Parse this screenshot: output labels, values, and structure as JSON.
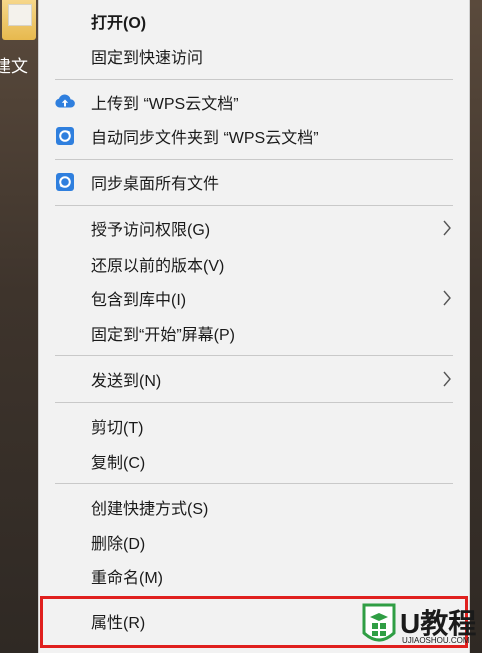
{
  "desktop": {
    "folder_label": "建文"
  },
  "menu": {
    "items": [
      {
        "label": "打开(O)",
        "bold": true
      },
      {
        "label": "固定到快速访问"
      },
      {
        "label": "上传到 “WPS云文档”",
        "icon": "cloud-upload-icon"
      },
      {
        "label": "自动同步文件夹到 “WPS云文档”",
        "icon": "sync-folder-icon"
      },
      {
        "label": "同步桌面所有文件",
        "icon": "sync-desktop-icon"
      },
      {
        "label": "授予访问权限(G)",
        "submenu": true
      },
      {
        "label": "还原以前的版本(V)"
      },
      {
        "label": "包含到库中(I)",
        "submenu": true
      },
      {
        "label": "固定到“开始”屏幕(P)"
      },
      {
        "label": "发送到(N)",
        "submenu": true
      },
      {
        "label": "剪切(T)"
      },
      {
        "label": "复制(C)"
      },
      {
        "label": "创建快捷方式(S)"
      },
      {
        "label": "删除(D)"
      },
      {
        "label": "重命名(M)"
      },
      {
        "label": "属性(R)",
        "highlighted": true
      }
    ]
  },
  "watermark": {
    "brand": "U教程",
    "url": "UJIAOSHOU.COM"
  },
  "colors": {
    "highlight": "#e0201e",
    "wps_blue": "#2f7fde",
    "watermark_green": "#2f9e44"
  }
}
